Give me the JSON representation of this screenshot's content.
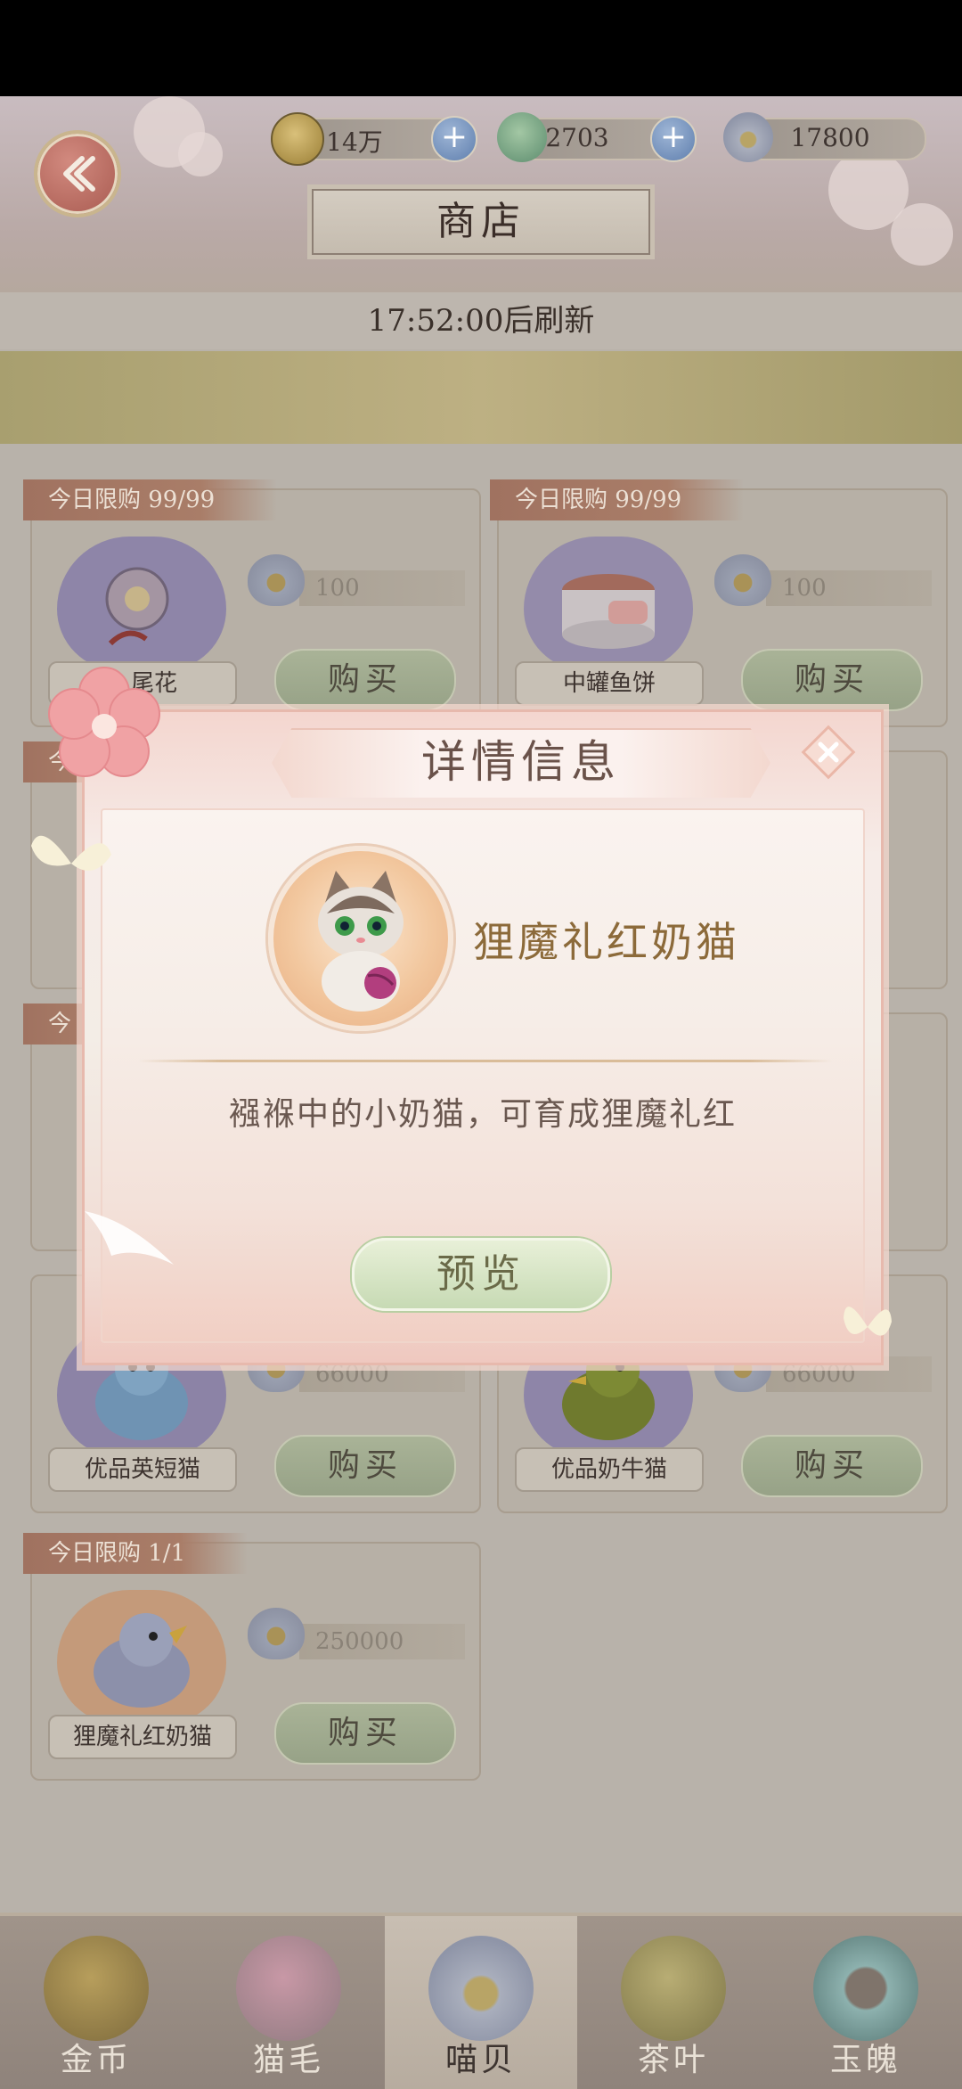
{
  "header": {
    "title": "商店",
    "refresh_text": "17:52:00后刷新",
    "currencies": [
      {
        "icon": "paw-coin-icon",
        "value": "14万"
      },
      {
        "icon": "cat-hair-icon",
        "value": "2703"
      },
      {
        "icon": "shell-icon",
        "value": "17800"
      }
    ]
  },
  "shop": {
    "items": [
      {
        "limit": "今日限购 99/99",
        "name": "？尾花",
        "price": "100",
        "buy": "购买"
      },
      {
        "limit": "今日限购 99/99",
        "name": "中罐鱼饼",
        "price": "100",
        "buy": "购买"
      },
      {
        "limit": "今",
        "name": "",
        "price": "",
        "buy": ""
      },
      {
        "limit": "",
        "name": "",
        "price": "",
        "buy": ""
      },
      {
        "limit": "今",
        "name": "优品英短猫",
        "price": "66000",
        "buy": "购买"
      },
      {
        "limit": "",
        "name": "优品奶牛猫",
        "price": "66000",
        "buy": "购买"
      },
      {
        "limit": "今日限购 1/1",
        "name": "狸魔礼红奶猫",
        "price": "250000",
        "buy": "购买"
      }
    ]
  },
  "dialog": {
    "title": "详情信息",
    "pet_name": "狸魔礼红奶猫",
    "description": "襁褓中的小奶猫，可育成狸魔礼红",
    "preview_label": "预览"
  },
  "tabs": [
    {
      "label": "金币",
      "icon": "paw-coin-icon",
      "active": false
    },
    {
      "label": "猫毛",
      "icon": "cat-hair-icon",
      "active": false
    },
    {
      "label": "喵贝",
      "icon": "shell-icon",
      "active": true
    },
    {
      "label": "茶叶",
      "icon": "tea-lock-icon",
      "active": false
    },
    {
      "label": "玉魄",
      "icon": "jade-disc-icon",
      "active": false
    }
  ],
  "colors": {
    "accent_pink": "#e7b9ad",
    "dialog_title": "#6a524a",
    "pet_name": "#8c6a3a",
    "preview_green": "#c7dab4"
  }
}
